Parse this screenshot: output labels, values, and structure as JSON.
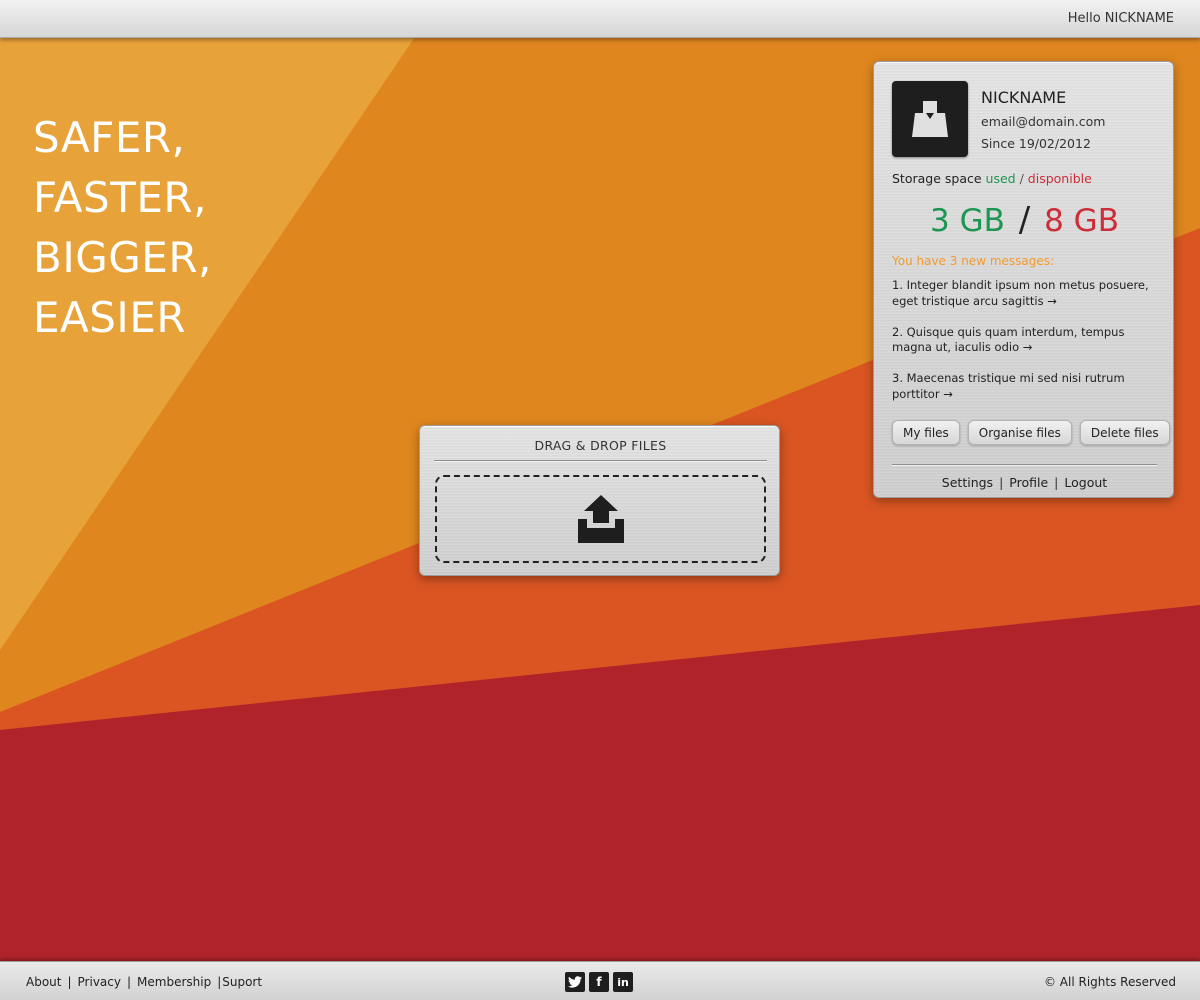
{
  "header": {
    "greeting": "Hello NICKNAME"
  },
  "hero": {
    "lines": [
      "SAFER,",
      "FASTER,",
      "BIGGER,",
      "EASIER"
    ]
  },
  "colors": {
    "band_light_orange": "#e8a23a",
    "band_orange": "#e0861f",
    "band_dark_orange": "#da5522",
    "band_red": "#b1232a",
    "used_green": "#1d9651",
    "disponible_red": "#cc2d38",
    "messages_orange": "#f29a2e"
  },
  "profile": {
    "avatar_icon": "user-silhouette-icon",
    "nickname": "NICKNAME",
    "email": "email@domain.com",
    "since": "Since 19/02/2012",
    "storage_label": "Storage space",
    "used_label": "used",
    "slash": "/",
    "disponible_label": "disponible",
    "used_amount": "3 GB",
    "total_amount": "8 GB",
    "messages_header": "You have 3 new messages:",
    "messages": [
      "1. Integer blandit ipsum non metus posuere, eget tristique arcu sagittis →",
      "2. Quisque quis quam interdum, tempus magna ut, iaculis odio →",
      "3. Maecenas tristique mi sed nisi rutrum porttitor →"
    ],
    "buttons": {
      "my_files": "My files",
      "organise_files": "Organise files",
      "delete_files": "Delete files"
    },
    "links": {
      "settings": "Settings",
      "profile": "Profile",
      "logout": "Logout",
      "separator": "|"
    }
  },
  "dropbox": {
    "title": "DRAG & DROP FILES",
    "icon": "upload-tray-icon"
  },
  "footer": {
    "links": {
      "about": "About",
      "privacy": "Privacy",
      "membership": "Membership",
      "suport": "Suport",
      "separator": "|"
    },
    "socials": {
      "twitter": "twitter-icon",
      "facebook": "facebook-icon",
      "facebook_glyph": "f",
      "linkedin": "linkedin-icon",
      "linkedin_glyph": "in"
    },
    "copyright": "©  All Rights Reserved"
  }
}
